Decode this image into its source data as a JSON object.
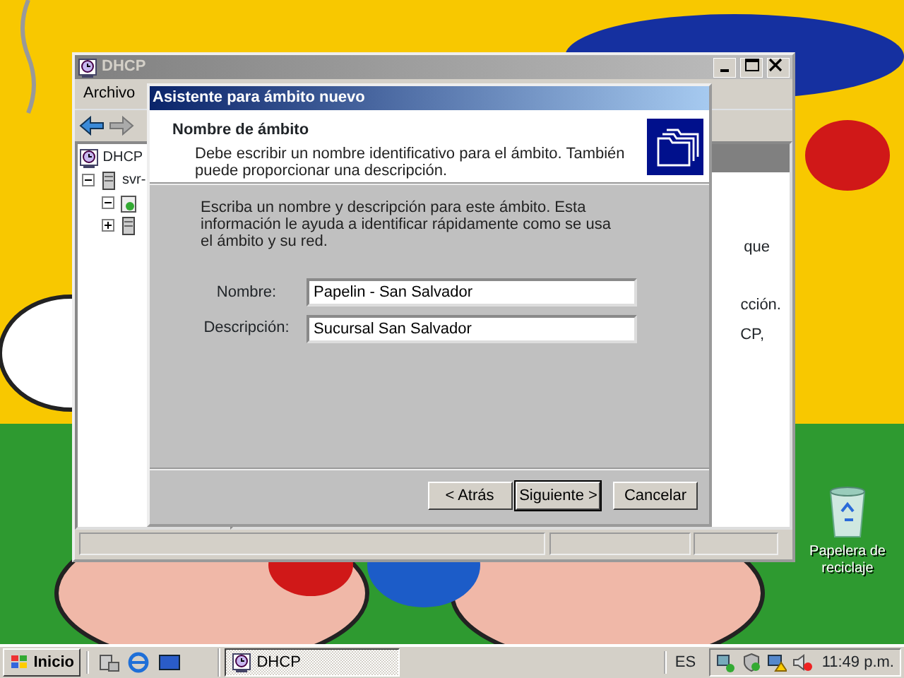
{
  "desktop": {
    "icons": [
      {
        "label": "Papelera de reciclaje"
      }
    ]
  },
  "main_window": {
    "title": "DHCP",
    "menu": [
      "Archivo"
    ],
    "tree": [
      {
        "kind": "root",
        "label": "DHCP",
        "children": [
          {
            "kind": "server",
            "label": "svr-",
            "expanded": true,
            "children": [
              {
                "kind": "scope",
                "expanded": true
              },
              {
                "kind": "server",
                "expanded": false
              }
            ]
          }
        ]
      }
    ],
    "pane_text": [
      "que",
      "cción.",
      "CP,"
    ]
  },
  "wizard": {
    "title": "Asistente para ámbito nuevo",
    "heading": "Nombre de ámbito",
    "subtitle": "Debe escribir un nombre identificativo para el ámbito. También puede proporcionar una descripción.",
    "intro": "Escriba un nombre y descripción para este ámbito. Esta información le ayuda a identificar rápidamente como se usa el ámbito y su red.",
    "fields": [
      {
        "label": "Nombre:",
        "value": "Papelin - San Salvador"
      },
      {
        "label": "Descripción:",
        "value": "Sucursal San Salvador"
      }
    ],
    "buttons": [
      {
        "label": "< Atrás",
        "default": false
      },
      {
        "label": "Siguiente >",
        "default": true
      },
      {
        "label": "Cancelar",
        "default": false
      }
    ]
  },
  "taskbar": {
    "start": "Inicio",
    "tasks": [
      {
        "label": "DHCP",
        "selected": true
      }
    ],
    "language": "ES",
    "clock": "11:49 p.m."
  }
}
